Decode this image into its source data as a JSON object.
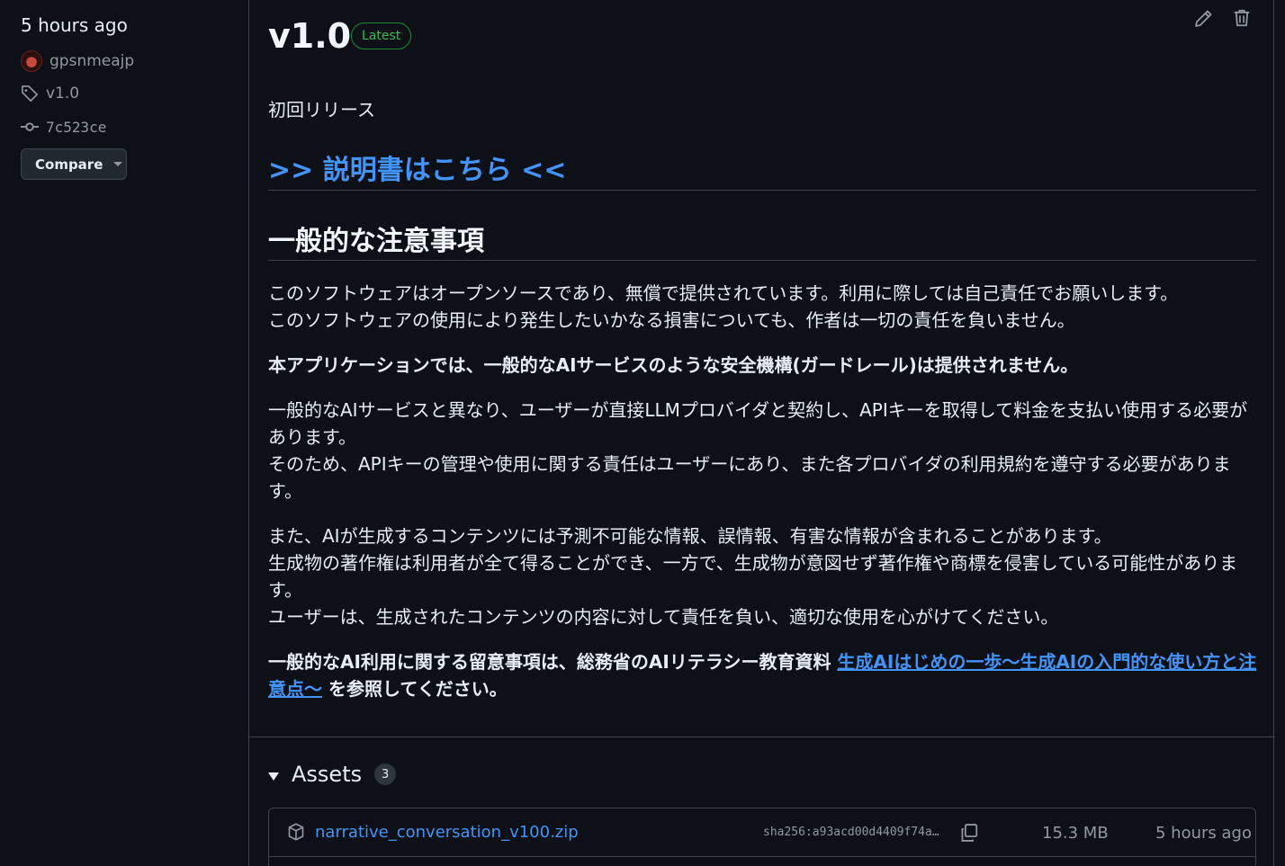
{
  "sidebar": {
    "time": "5 hours ago",
    "author": "gpsnmeajp",
    "tag": "v1.0",
    "commit": "7c523ce",
    "compare_label": "Compare"
  },
  "release": {
    "title": "v1.0",
    "badge": "Latest",
    "intro": "初回リリース",
    "manual_link": ">> 説明書はこちら <<",
    "section_heading": "一般的な注意事項",
    "para1_line1": "このソフトウェアはオープンソースであり、無償で提供されています。利用に際しては自己責任でお願いします。",
    "para1_line2": "このソフトウェアの使用により発生したいかなる損害についても、作者は一切の責任を負いません。",
    "para2_bold": "本アプリケーションでは、一般的なAIサービスのような安全機構(ガードレール)は提供されません。",
    "para3_line1": "一般的なAIサービスと異なり、ユーザーが直接LLMプロバイダと契約し、APIキーを取得して料金を支払い使用する必要があります。",
    "para3_line2": "そのため、APIキーの管理や使用に関する責任はユーザーにあり、また各プロバイダの利用規約を遵守する必要があります。",
    "para4_line1": "また、AIが生成するコンテンツには予測不可能な情報、誤情報、有害な情報が含まれることがあります。",
    "para4_line2": "生成物の著作権は利用者が全て得ることができ、一方で、生成物が意図せず著作権や商標を侵害している可能性があります。",
    "para4_line3": "ユーザーは、生成されたコンテンツの内容に対して責任を負い、適切な使用を心がけてください。",
    "para5_prefix": "一般的なAI利用に関する留意事項は、総務省のAIリテラシー教育資料 ",
    "para5_link": "生成AIはじめの一歩～生成AIの入門的な使い方と注意点～",
    "para5_suffix": " を参照してください。"
  },
  "assets": {
    "title": "Assets",
    "count": "3",
    "items": [
      {
        "name": "narrative_conversation_v100.zip",
        "sha": "sha256:a93acd00d4409f74a…",
        "size": "15.3 MB",
        "time": "5 hours ago"
      }
    ]
  },
  "colors": {
    "background": "#0d1117",
    "link": "#4493f8",
    "latest_green": "#3fb950",
    "border": "#3d444d"
  },
  "icons": [
    "tag-icon",
    "commit-icon",
    "pencil-icon",
    "trash-icon",
    "package-icon",
    "copy-icon"
  ]
}
